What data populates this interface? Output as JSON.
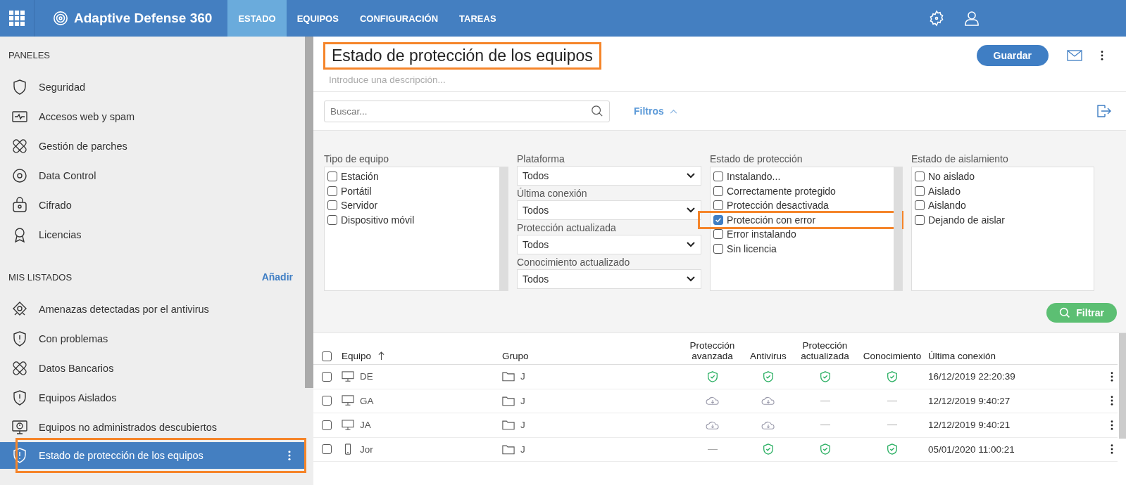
{
  "topbar": {
    "brand": "Adaptive Defense 360",
    "tabs": [
      {
        "label": "ESTADO",
        "selected": true
      },
      {
        "label": "EQUIPOS",
        "selected": false
      },
      {
        "label": "CONFIGURACIÓN",
        "selected": false
      },
      {
        "label": "TAREAS",
        "selected": false
      }
    ]
  },
  "sidebar": {
    "panels_heading": "PANELES",
    "panels": [
      {
        "label": "Seguridad",
        "selected": false
      },
      {
        "label": "Accesos web y spam",
        "selected": false
      },
      {
        "label": "Gestión de parches",
        "selected": false
      },
      {
        "label": "Data Control",
        "selected": false
      },
      {
        "label": "Cifrado",
        "selected": false
      },
      {
        "label": "Licencias",
        "selected": false
      }
    ],
    "lists_heading": "MIS LISTADOS",
    "add_link": "Añadir",
    "lists": [
      {
        "label": "Amenazas detectadas por el antivirus",
        "selected": false,
        "highlighted": false
      },
      {
        "label": "Con problemas",
        "selected": false,
        "highlighted": false
      },
      {
        "label": "Datos Bancarios",
        "selected": false,
        "highlighted": false
      },
      {
        "label": "Equipos Aislados",
        "selected": false,
        "highlighted": false
      },
      {
        "label": "Equipos no administrados descubiertos",
        "selected": false,
        "highlighted": false
      },
      {
        "label": "Estado de protección de los equipos",
        "selected": true,
        "highlighted": true
      }
    ]
  },
  "header": {
    "title": "Estado de protección de los equipos",
    "title_highlighted": true,
    "description_placeholder": "Introduce una descripción...",
    "save_button": "Guardar"
  },
  "toolbar": {
    "search_placeholder": "Buscar...",
    "filters_link": "Filtros",
    "filters_expanded": true
  },
  "filters": {
    "device_type": {
      "label": "Tipo de equipo",
      "options": [
        {
          "label": "Estación",
          "checked": false
        },
        {
          "label": "Portátil",
          "checked": false
        },
        {
          "label": "Servidor",
          "checked": false
        },
        {
          "label": "Dispositivo móvil",
          "checked": false
        }
      ]
    },
    "selects": [
      {
        "label": "Plataforma",
        "value": "Todos"
      },
      {
        "label": "Última conexión",
        "value": "Todos"
      },
      {
        "label": "Protección actualizada",
        "value": "Todos"
      },
      {
        "label": "Conocimiento actualizado",
        "value": "Todos"
      }
    ],
    "protection_state": {
      "label": "Estado de protección",
      "options": [
        {
          "label": "Instalando...",
          "checked": false,
          "highlighted": false
        },
        {
          "label": "Correctamente protegido",
          "checked": false,
          "highlighted": false
        },
        {
          "label": "Protección desactivada",
          "checked": false,
          "highlighted": false
        },
        {
          "label": "Protección con error",
          "checked": true,
          "highlighted": true
        },
        {
          "label": "Error instalando",
          "checked": false,
          "highlighted": false
        },
        {
          "label": "Sin licencia",
          "checked": false,
          "highlighted": false
        }
      ]
    },
    "isolation_state": {
      "label": "Estado de aislamiento",
      "options": [
        {
          "label": "No aislado",
          "checked": false
        },
        {
          "label": "Aislado",
          "checked": false
        },
        {
          "label": "Aislando",
          "checked": false
        },
        {
          "label": "Dejando de aislar",
          "checked": false
        }
      ]
    },
    "filter_button": "Filtrar"
  },
  "table": {
    "columns": [
      {
        "label": "Equipo",
        "sorted": true
      },
      {
        "label": "Grupo",
        "sorted": false
      },
      {
        "label": "Protección avanzada",
        "sorted": false
      },
      {
        "label": "Antivirus",
        "sorted": false
      },
      {
        "label": "Protección actualizada",
        "sorted": false
      },
      {
        "label": "Conocimiento",
        "sorted": false
      },
      {
        "label": "Última conexión",
        "sorted": false
      }
    ],
    "all_checked": false,
    "rows": [
      {
        "checked": false,
        "device": {
          "kind": "desktop",
          "name": "DE"
        },
        "group": "J",
        "status": [
          {
            "kind": "ok"
          },
          {
            "kind": "ok"
          },
          {
            "kind": "ok"
          },
          {
            "kind": "ok"
          }
        ],
        "last_connection": "16/12/2019 22:20:39"
      },
      {
        "checked": false,
        "device": {
          "kind": "desktop",
          "name": "GA"
        },
        "group": "J",
        "status": [
          {
            "kind": "pending"
          },
          {
            "kind": "pending"
          },
          {
            "kind": "none"
          },
          {
            "kind": "none"
          }
        ],
        "last_connection": "12/12/2019 9:40:27"
      },
      {
        "checked": false,
        "device": {
          "kind": "desktop",
          "name": "JA"
        },
        "group": "J",
        "status": [
          {
            "kind": "pending"
          },
          {
            "kind": "pending"
          },
          {
            "kind": "none"
          },
          {
            "kind": "none"
          }
        ],
        "last_connection": "12/12/2019 9:40:21"
      },
      {
        "checked": false,
        "device": {
          "kind": "mobile",
          "name": "Jor"
        },
        "group": "J",
        "status": [
          {
            "kind": "none"
          },
          {
            "kind": "ok"
          },
          {
            "kind": "ok"
          },
          {
            "kind": "ok"
          }
        ],
        "last_connection": "05/01/2020 11:00:21"
      }
    ]
  }
}
